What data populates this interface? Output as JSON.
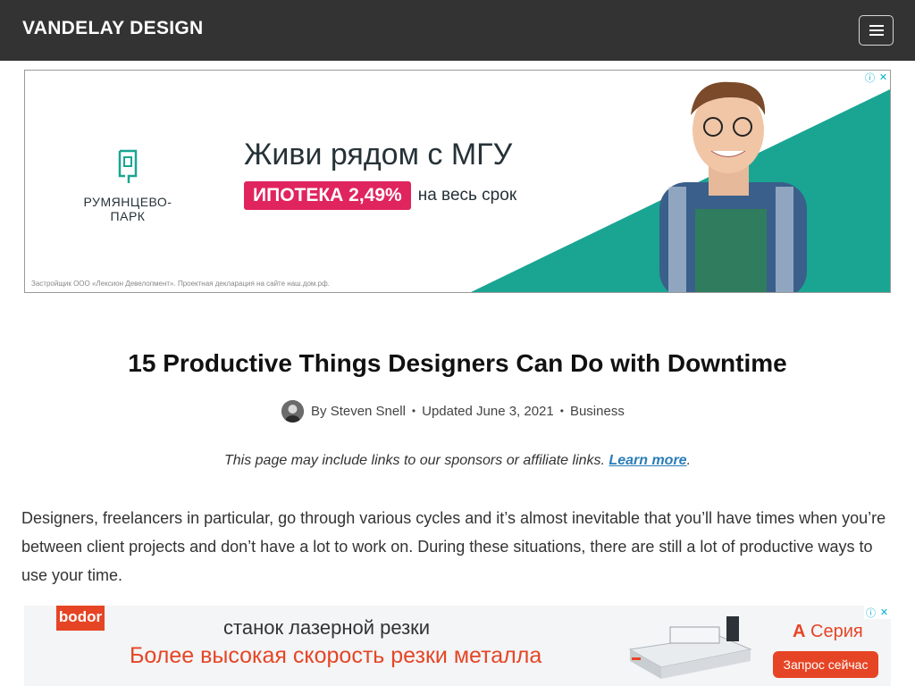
{
  "header": {
    "site_title": "VANDELAY DESIGN",
    "menu_icon": "hamburger-menu-icon"
  },
  "ad_top": {
    "brand": "РУМЯНЦЕВО-ПАРК",
    "headline": "Живи рядом с МГУ",
    "promo_badge": "ИПОТЕКА 2,49%",
    "promo_rest": "на весь срок",
    "disclaimer": "Застройщик ООО «Лексион Девелопмент». Проектная декларация на сайте наш.дом.рф.",
    "accent_color": "#1aa593",
    "badge_color": "#e0245e",
    "choices_icons": [
      "info-icon",
      "close-icon"
    ]
  },
  "article": {
    "title": "15 Productive Things Designers Can Do with Downtime",
    "author_prefix": "By",
    "author": "Steven Snell",
    "updated": "Updated June 3, 2021",
    "category": "Business",
    "disclaimer_text": "This page may include links to our sponsors or affiliate links.",
    "disclaimer_link": "Learn more",
    "disclaimer_end": ".",
    "intro": "Designers, freelancers in particular, go through various cycles and it’s almost inevitable that you’ll have times when you’re between client projects and don’t have a lot to work on. During these situations, there are still a lot of productive ways to use your time."
  },
  "ad_bottom": {
    "brand": "bodor",
    "line1": "станок лазерной резки",
    "line2": "Более высокая скорость резки металла",
    "series_letter": "A",
    "series_word": "Серия",
    "cta": "Запрос сейчас",
    "brand_color": "#e64525"
  }
}
